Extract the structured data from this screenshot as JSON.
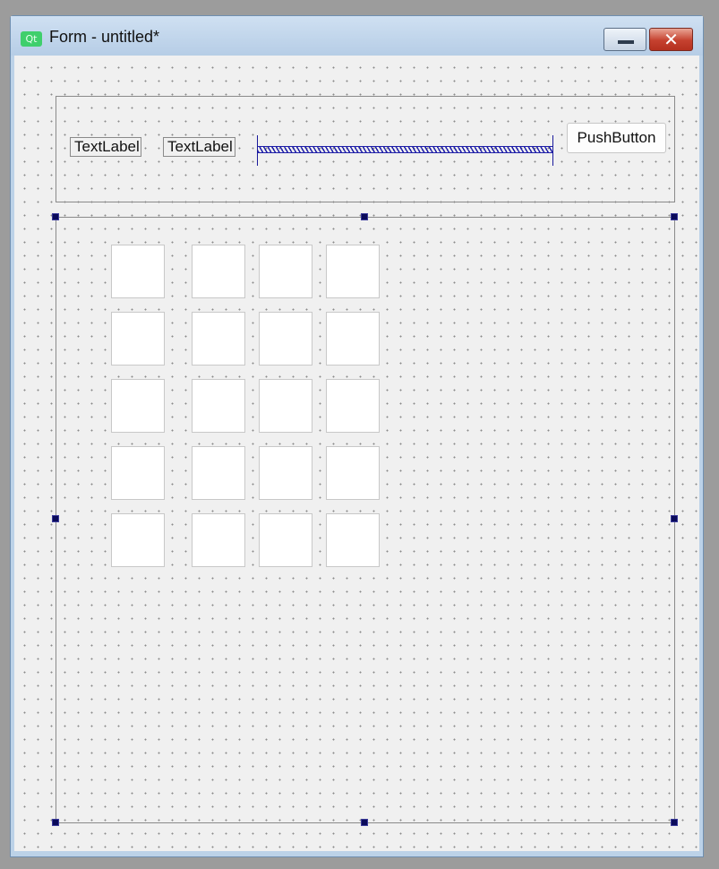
{
  "window": {
    "title": "Form - untitled*",
    "icon_text": "Qt",
    "close_glyph": "✕"
  },
  "top_layout": {
    "label1": "TextLabel",
    "label2": "TextLabel",
    "button": "PushButton"
  },
  "grid": {
    "rows": 5,
    "columns": 4
  },
  "colors": {
    "selection_handle": "#0a0a5a",
    "spacer": "#1f1fa8",
    "close_button": "#c5412f",
    "qt_icon": "#3fcf6c"
  }
}
